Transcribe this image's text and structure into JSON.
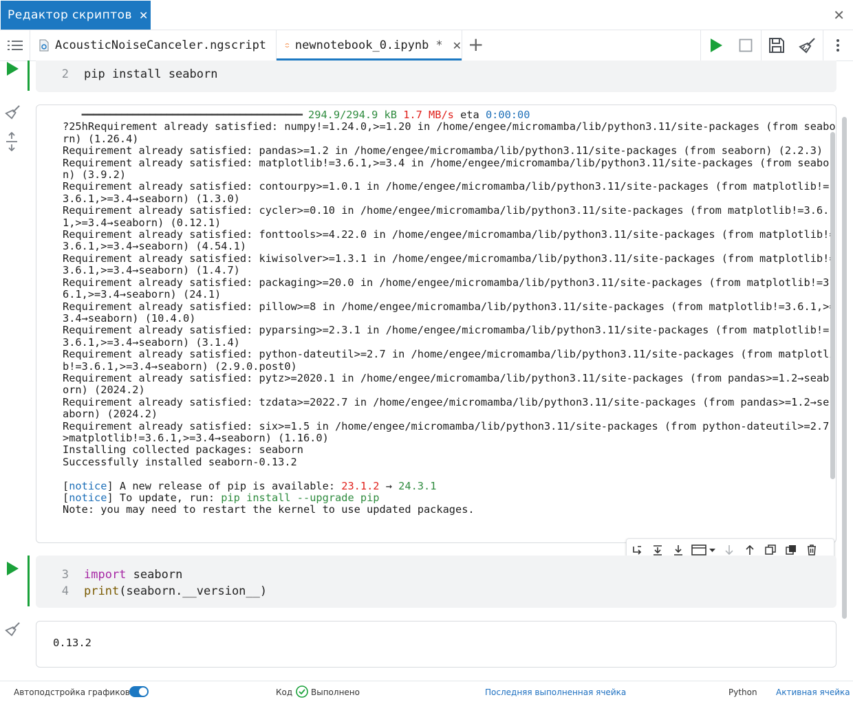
{
  "panel": {
    "title": "Редактор скриптов",
    "close_tab": "✕",
    "close_panel": "✕"
  },
  "tabs": [
    {
      "label": "AcousticNoiseCanceler.ngscript"
    },
    {
      "label": "newnotebook_0.ipynb",
      "modified": "*",
      "close": "✕"
    }
  ],
  "toolbar": {
    "add_tab": "+"
  },
  "cells": {
    "cell2": {
      "line_no": "2",
      "code": "pip install seaborn"
    },
    "cell3": {
      "lines": [
        {
          "no": "3",
          "kw": "import",
          "rest": " seaborn"
        },
        {
          "no": "4",
          "fn": "print",
          "rest": "(seaborn.__version__)"
        }
      ]
    }
  },
  "output1": {
    "progress": {
      "bar": "━━━━━━━━━━━━━━━━━━━━━━━━━━━━━━━━━━━━━━━",
      "size": "294.9/294.9 kB",
      "speed": "1.7 MB/s",
      "eta_label": "eta",
      "eta": "0:00:00"
    },
    "lines": [
      "?25hRequirement already satisfied: numpy!=1.24.0,>=1.20 in /home/engee/micromamba/lib/python3.11/site-packages (from seabo",
      "rn) (1.26.4)",
      "Requirement already satisfied: pandas>=1.2 in /home/engee/micromamba/lib/python3.11/site-packages (from seaborn) (2.2.3)",
      "Requirement already satisfied: matplotlib!=3.6.1,>=3.4 in /home/engee/micromamba/lib/python3.11/site-packages (from seabor",
      "n) (3.9.2)",
      "Requirement already satisfied: contourpy>=1.0.1 in /home/engee/micromamba/lib/python3.11/site-packages (from matplotlib!=",
      "3.6.1,>=3.4→seaborn) (1.3.0)",
      "Requirement already satisfied: cycler>=0.10 in /home/engee/micromamba/lib/python3.11/site-packages (from matplotlib!=3.6.",
      "1,>=3.4→seaborn) (0.12.1)",
      "Requirement already satisfied: fonttools>=4.22.0 in /home/engee/micromamba/lib/python3.11/site-packages (from matplotlib!=",
      "3.6.1,>=3.4→seaborn) (4.54.1)",
      "Requirement already satisfied: kiwisolver>=1.3.1 in /home/engee/micromamba/lib/python3.11/site-packages (from matplotlib!=",
      "3.6.1,>=3.4→seaborn) (1.4.7)",
      "Requirement already satisfied: packaging>=20.0 in /home/engee/micromamba/lib/python3.11/site-packages (from matplotlib!=3.",
      "6.1,>=3.4→seaborn) (24.1)",
      "Requirement already satisfied: pillow>=8 in /home/engee/micromamba/lib/python3.11/site-packages (from matplotlib!=3.6.1,>=",
      "3.4→seaborn) (10.4.0)",
      "Requirement already satisfied: pyparsing>=2.3.1 in /home/engee/micromamba/lib/python3.11/site-packages (from matplotlib!=",
      "3.6.1,>=3.4→seaborn) (3.1.4)",
      "Requirement already satisfied: python-dateutil>=2.7 in /home/engee/micromamba/lib/python3.11/site-packages (from matplotli",
      "b!=3.6.1,>=3.4→seaborn) (2.9.0.post0)",
      "Requirement already satisfied: pytz>=2020.1 in /home/engee/micromamba/lib/python3.11/site-packages (from pandas>=1.2→seab",
      "orn) (2024.2)",
      "Requirement already satisfied: tzdata>=2022.7 in /home/engee/micromamba/lib/python3.11/site-packages (from pandas>=1.2→se",
      "aborn) (2024.2)",
      "Requirement already satisfied: six>=1.5 in /home/engee/micromamba/lib/python3.11/site-packages (from python-dateutil>=2.7-",
      ">matplotlib!=3.6.1,>=3.4→seaborn) (1.16.0)",
      "Installing collected packages: seaborn",
      "Successfully installed seaborn-0.13.2"
    ],
    "notice1": {
      "tag": "notice",
      "text": " A new release of pip is available: ",
      "old": "23.1.2",
      "arrow": " → ",
      "new": "24.3.1"
    },
    "notice2": {
      "tag": "notice",
      "text": " To update, run: ",
      "cmd": "pip install --upgrade pip"
    },
    "note": "Note: you may need to restart the kernel to use updated packages."
  },
  "output2": {
    "text": "0.13.2"
  },
  "status": {
    "autotune": "Автоподстройка графиков",
    "mode": "Код",
    "state": "Выполнено",
    "last_cell": "Последняя выполненная ячейка",
    "kernel": "Python",
    "active_cell": "Активная ячейка"
  },
  "colors": {
    "accent": "#1c78c2",
    "run": "#1aa13a"
  }
}
